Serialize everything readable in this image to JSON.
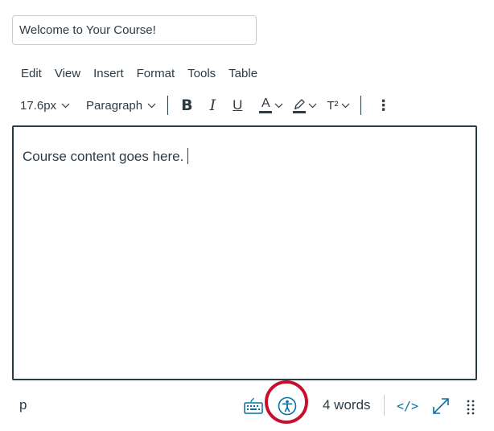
{
  "title_field": {
    "value": "Welcome to Your Course!"
  },
  "menubar": {
    "items": [
      "Edit",
      "View",
      "Insert",
      "Format",
      "Tools",
      "Table"
    ]
  },
  "toolbar": {
    "font_size": "17.6px",
    "block_format": "Paragraph",
    "bold_glyph": "B",
    "italic_glyph": "I",
    "underline_glyph": "U",
    "text_color_glyph": "A",
    "superscript_glyph": "T²",
    "more_glyph": "⋮"
  },
  "editor": {
    "content": "Course content goes here."
  },
  "statusbar": {
    "element_path": "p",
    "word_count": "4 words",
    "html_toggle": "</>"
  },
  "colors": {
    "text": "#2d3b45",
    "accent": "#0770a3",
    "highlight_ring": "#c8102e",
    "border": "#c7cdd1"
  },
  "icons": [
    "chevron-down-icon",
    "highlight-pen-icon",
    "keyboard-icon",
    "accessibility-icon",
    "fullscreen-icon",
    "resize-grip-icon"
  ]
}
